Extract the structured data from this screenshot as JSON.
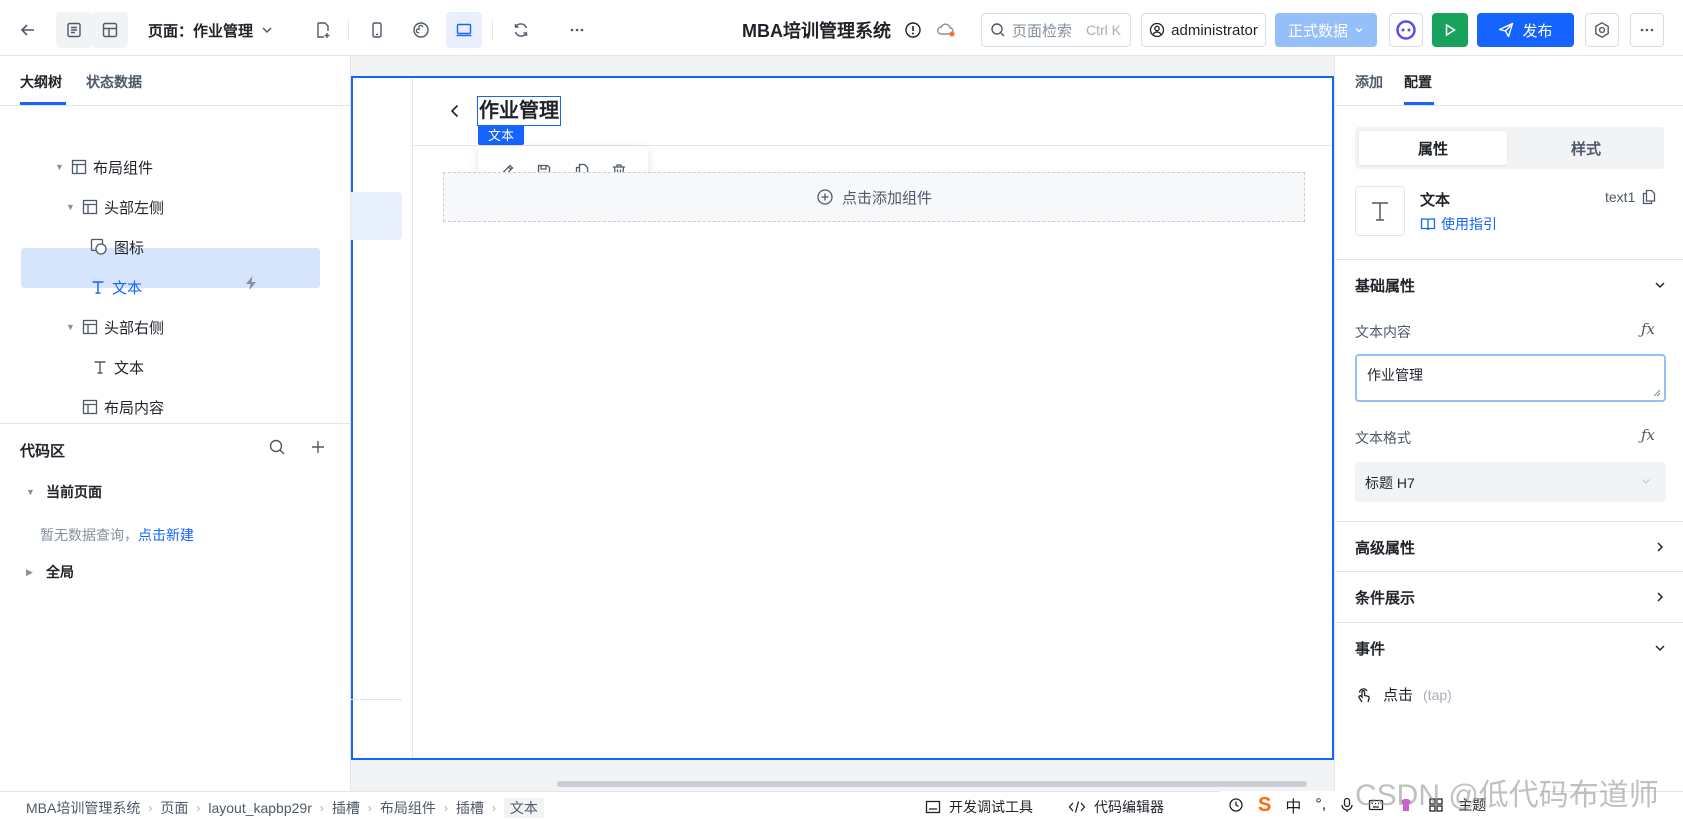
{
  "toolbar": {
    "page_label": "页面：作业管理",
    "app_title": "MBA培训管理系统",
    "search_placeholder": "页面检索",
    "search_shortcut": "Ctrl K",
    "user": "administrator",
    "data_mode": "正式数据",
    "publish": "发布"
  },
  "left_panel": {
    "tabs": [
      "大纲树",
      "状态数据"
    ],
    "tree": [
      {
        "label": "布局组件"
      },
      {
        "label": "头部左侧"
      },
      {
        "label": "图标"
      },
      {
        "label": "文本"
      },
      {
        "label": "头部右侧"
      },
      {
        "label": "文本"
      },
      {
        "label": "布局内容"
      }
    ],
    "code_area": {
      "title": "代码区",
      "current_page": "当前页面",
      "empty_text": "暂无数据查询，",
      "create_link": "点击新建",
      "global": "全局"
    }
  },
  "canvas": {
    "page_title": "作业管理",
    "selection_tag": "文本",
    "add_component": "点击添加组件"
  },
  "right_panel": {
    "tabs": [
      "添加",
      "配置"
    ],
    "segments": [
      "属性",
      "样式"
    ],
    "component": {
      "name": "文本",
      "id": "text1",
      "guide": "使用指引"
    },
    "sections": {
      "basic": "基础属性",
      "advanced": "高级属性",
      "condition": "条件展示",
      "events": "事件"
    },
    "fields": {
      "text_content_label": "文本内容",
      "text_content_value": "作业管理",
      "text_format_label": "文本格式",
      "text_format_value": "标题 H7",
      "fx": "ƒx"
    },
    "event": {
      "label": "点击",
      "code": "(tap)"
    }
  },
  "status_bar": {
    "breadcrumb": [
      "MBA培训管理系统",
      "页面",
      "layout_kapbp29r",
      "插槽",
      "布局组件",
      "插槽",
      "文本"
    ],
    "dev_tools": "开发调试工具",
    "code_editor": "代码编辑器",
    "ime": {
      "mode": "中",
      "punct": "°,",
      "theme": "主题"
    }
  },
  "watermark": "CSDN @低代码布道师",
  "colors": {
    "accent": "#1664ff",
    "run": "#17a35b",
    "data_mode_bg": "#94bff8"
  }
}
